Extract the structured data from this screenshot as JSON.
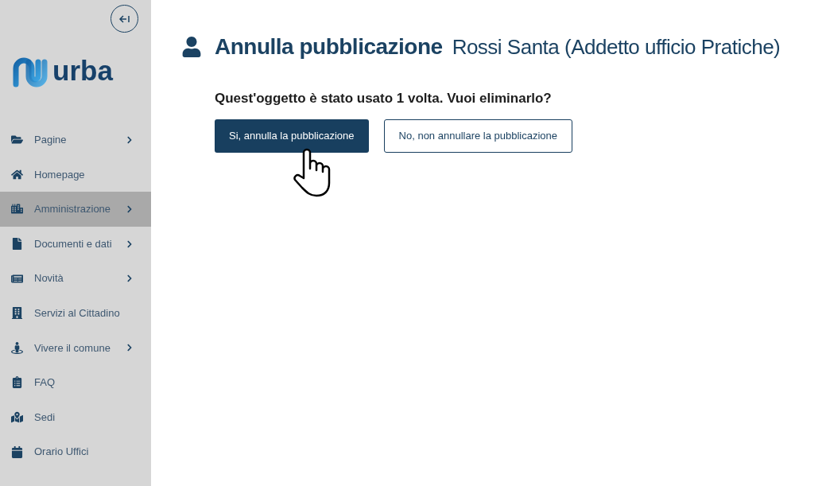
{
  "sidebar": {
    "logo_text": "urba",
    "items": [
      {
        "label": "Pagine",
        "has_submenu": true,
        "selected": false
      },
      {
        "label": "Homepage",
        "has_submenu": false,
        "selected": false
      },
      {
        "label": "Amministrazione",
        "has_submenu": true,
        "selected": true
      },
      {
        "label": "Documenti e dati",
        "has_submenu": true,
        "selected": false
      },
      {
        "label": "Novità",
        "has_submenu": true,
        "selected": false
      },
      {
        "label": "Servizi al Cittadino",
        "has_submenu": false,
        "selected": false
      },
      {
        "label": "Vivere il comune",
        "has_submenu": true,
        "selected": false
      },
      {
        "label": "FAQ",
        "has_submenu": false,
        "selected": false
      },
      {
        "label": "Sedi",
        "has_submenu": false,
        "selected": false
      },
      {
        "label": "Orario Uffici",
        "has_submenu": false,
        "selected": false
      }
    ]
  },
  "header": {
    "title": "Annulla pubblicazione",
    "subtitle": "Rossi Santa (Addetto ufficio Pratiche)"
  },
  "question": "Quest'oggetto è stato usato 1 volta. Vuoi eliminarlo?",
  "buttons": [
    {
      "label": "Si, annulla la pubblicazione",
      "kind": "primary"
    },
    {
      "label": "No, non annullare la pubblicazione",
      "kind": "secondary"
    }
  ]
}
